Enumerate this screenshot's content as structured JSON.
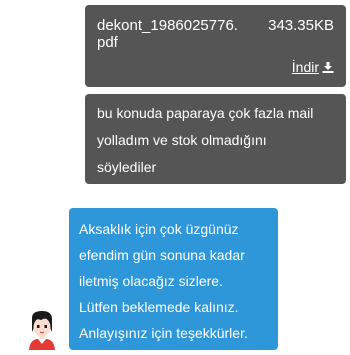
{
  "messages": {
    "file": {
      "name": "dekont_1986025776.",
      "ext": "pdf",
      "size": "343.35KB",
      "download_label": "İndir",
      "icon": "download-icon"
    },
    "user_text": [
      "bu konuda paparaya çok fazla mail",
      "yolladım ve stok olmadığını",
      "söylediler"
    ],
    "agent_text": [
      "Aksaklık için çok üzgünüz",
      "efendim gün sonuna kadar",
      "iletmiş olacağız sizlere.",
      "Lütfen beklemede kalınız.",
      "Anlayışınız için teşekkürler."
    ]
  },
  "colors": {
    "user_bubble": "#555555",
    "agent_bubble": "#2d97d9",
    "text": "#ffffff"
  },
  "icons": {
    "avatar": "agent-avatar-icon"
  }
}
